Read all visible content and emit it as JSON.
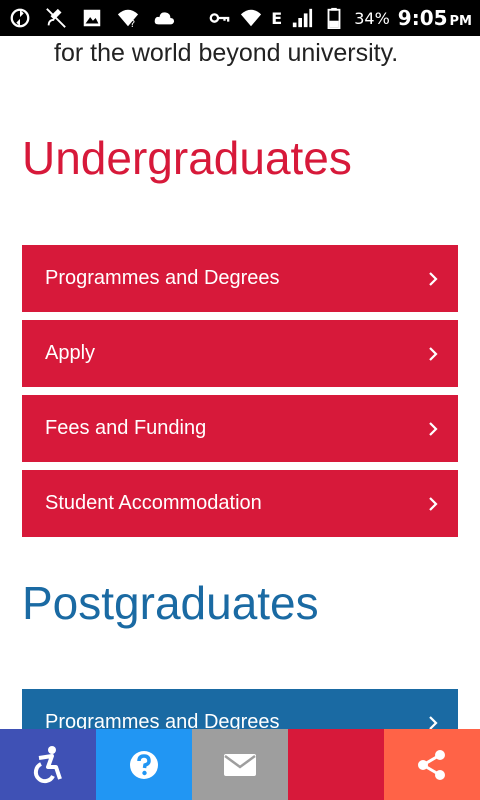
{
  "status_bar": {
    "network_type": "E",
    "battery_percent": "34%",
    "time": "9:05",
    "am_pm": "PM"
  },
  "intro": {
    "text": "for the world beyond university."
  },
  "undergraduates": {
    "title": "Undergraduates",
    "links": [
      {
        "label": "Programmes and Degrees"
      },
      {
        "label": "Apply"
      },
      {
        "label": "Fees and Funding"
      },
      {
        "label": "Student Accommodation"
      }
    ]
  },
  "postgraduates": {
    "title": "Postgraduates",
    "links": [
      {
        "label": "Programmes and Degrees"
      }
    ]
  },
  "bottom_bar": {
    "buttons": [
      {
        "icon": "accessibility-icon",
        "color": "#3f51b5"
      },
      {
        "icon": "help-icon",
        "color": "#2196f3"
      },
      {
        "icon": "email-icon",
        "color": "#9e9e9e"
      },
      {
        "icon": "blank",
        "color": "#d7193a"
      },
      {
        "icon": "share-icon",
        "color": "#ff6347"
      }
    ]
  },
  "colors": {
    "undergrad_accent": "#d7193a",
    "postgrad_accent": "#1a6aa3"
  }
}
